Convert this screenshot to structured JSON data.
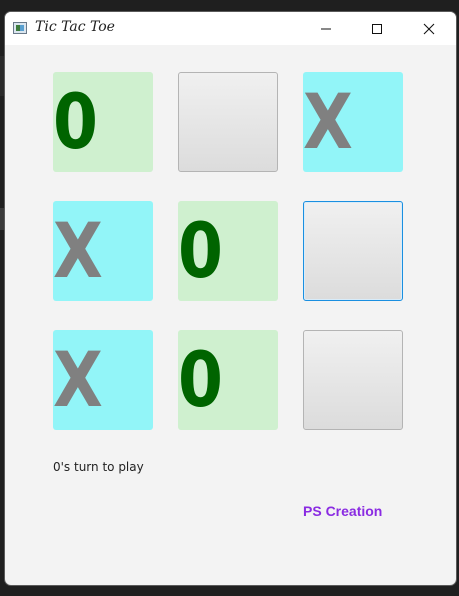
{
  "window": {
    "title": "Tic Tac Toe",
    "controls": [
      "minimize",
      "maximize",
      "close"
    ]
  },
  "board": {
    "cells": [
      {
        "mark": "0",
        "state": "filled-o"
      },
      {
        "mark": "",
        "state": "empty"
      },
      {
        "mark": "X",
        "state": "filled-x"
      },
      {
        "mark": "X",
        "state": "filled-x"
      },
      {
        "mark": "0",
        "state": "filled-o"
      },
      {
        "mark": "",
        "state": "empty-focused"
      },
      {
        "mark": "X",
        "state": "filled-x"
      },
      {
        "mark": "0",
        "state": "filled-o"
      },
      {
        "mark": "",
        "state": "empty"
      }
    ]
  },
  "status_text": "0's turn to play",
  "credit_text": "PS Creation",
  "colors": {
    "o_mark": "#006400",
    "o_cell": "#cff0cf",
    "x_mark": "#808080",
    "x_cell": "#92f5f8",
    "credit": "#8a2be2"
  }
}
